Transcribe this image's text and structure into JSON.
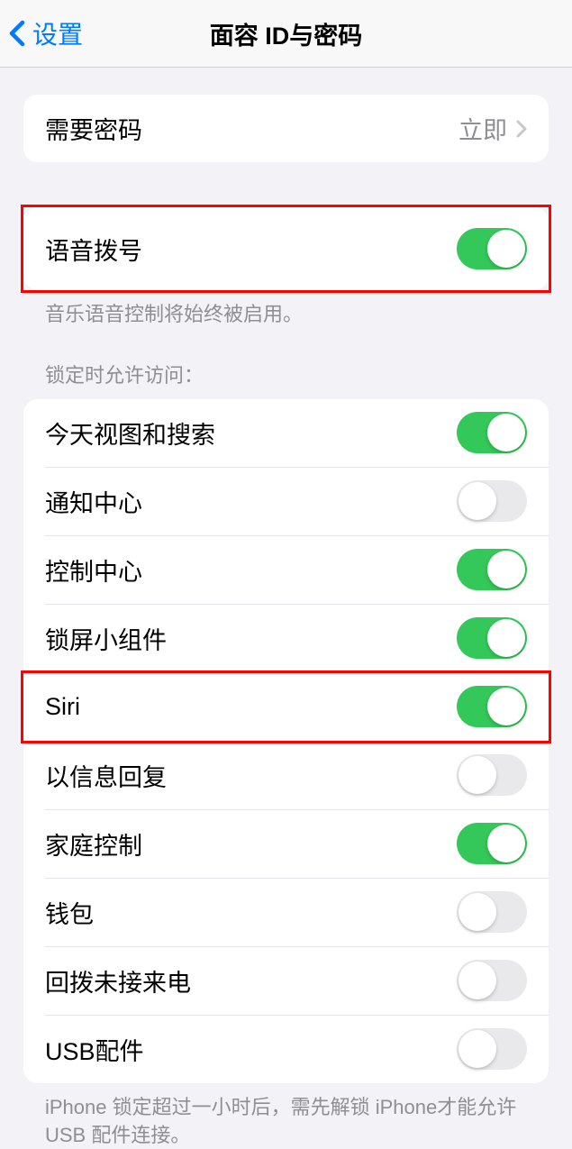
{
  "nav": {
    "back_label": "设置",
    "title": "面容 ID与密码"
  },
  "section1": {
    "require_passcode_label": "需要密码",
    "require_passcode_value": "立即"
  },
  "section2": {
    "voice_dial_label": "语音拨号",
    "voice_dial_on": true,
    "footer": "音乐语音控制将始终被启用。"
  },
  "section3": {
    "header": "锁定时允许访问：",
    "items": [
      {
        "label": "今天视图和搜索",
        "on": true
      },
      {
        "label": "通知中心",
        "on": false
      },
      {
        "label": "控制中心",
        "on": true
      },
      {
        "label": "锁屏小组件",
        "on": true
      },
      {
        "label": "Siri",
        "on": true
      },
      {
        "label": "以信息回复",
        "on": false
      },
      {
        "label": "家庭控制",
        "on": true
      },
      {
        "label": "钱包",
        "on": false
      },
      {
        "label": "回拨未接来电",
        "on": false
      },
      {
        "label": "USB配件",
        "on": false
      }
    ],
    "footer": "iPhone 锁定超过一小时后，需先解锁 iPhone才能允许USB 配件连接。"
  }
}
